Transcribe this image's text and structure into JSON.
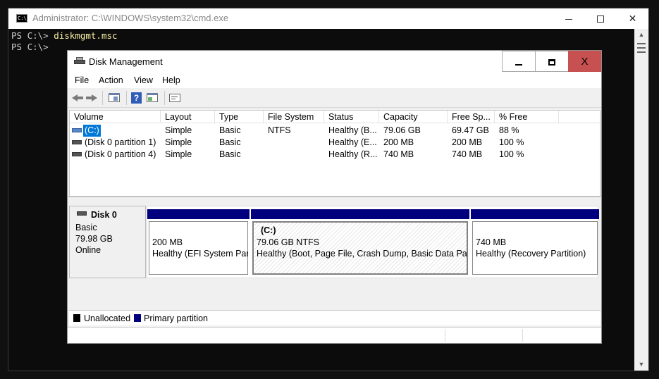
{
  "cmd": {
    "title": "Administrator: C:\\WINDOWS\\system32\\cmd.exe",
    "icon_text": "C:\\_",
    "lines": [
      {
        "prompt": "PS C:\\> ",
        "command": "diskmgmt.msc"
      },
      {
        "prompt": "PS C:\\> ",
        "command": ""
      }
    ]
  },
  "dm": {
    "title": "Disk Management",
    "close_glyph": "X",
    "menu": {
      "file": "File",
      "action": "Action",
      "view": "View",
      "help": "Help"
    },
    "toolbar": {
      "help_glyph": "?"
    },
    "columns": [
      "Volume",
      "Layout",
      "Type",
      "File System",
      "Status",
      "Capacity",
      "Free Sp...",
      "% Free"
    ],
    "volumes": [
      {
        "name": "(C:)",
        "layout": "Simple",
        "type": "Basic",
        "fs": "NTFS",
        "status": "Healthy (B...",
        "capacity": "79.06 GB",
        "free": "69.47 GB",
        "pct": "88 %"
      },
      {
        "name": "(Disk 0 partition 1)",
        "layout": "Simple",
        "type": "Basic",
        "fs": "",
        "status": "Healthy (E...",
        "capacity": "200 MB",
        "free": "200 MB",
        "pct": "100 %"
      },
      {
        "name": "(Disk 0 partition 4)",
        "layout": "Simple",
        "type": "Basic",
        "fs": "",
        "status": "Healthy (R...",
        "capacity": "740 MB",
        "free": "740 MB",
        "pct": "100 %"
      }
    ],
    "disk": {
      "name": "Disk 0",
      "type": "Basic",
      "size": "79.98 GB",
      "status": "Online"
    },
    "partitions": [
      {
        "label": "",
        "size": "200 MB",
        "status": "Healthy (EFI System Part"
      },
      {
        "label": "(C:)",
        "size": "79.06 GB NTFS",
        "status": "Healthy (Boot, Page File, Crash Dump, Basic Data Partiti"
      },
      {
        "label": "",
        "size": "740 MB",
        "status": "Healthy (Recovery Partition)"
      }
    ],
    "legend": {
      "unallocated": "Unallocated",
      "primary": "Primary partition"
    },
    "colors": {
      "primary_partition": "#00007f",
      "unallocated": "#000000",
      "selection": "#0078d7",
      "close_button": "#c75050"
    }
  }
}
